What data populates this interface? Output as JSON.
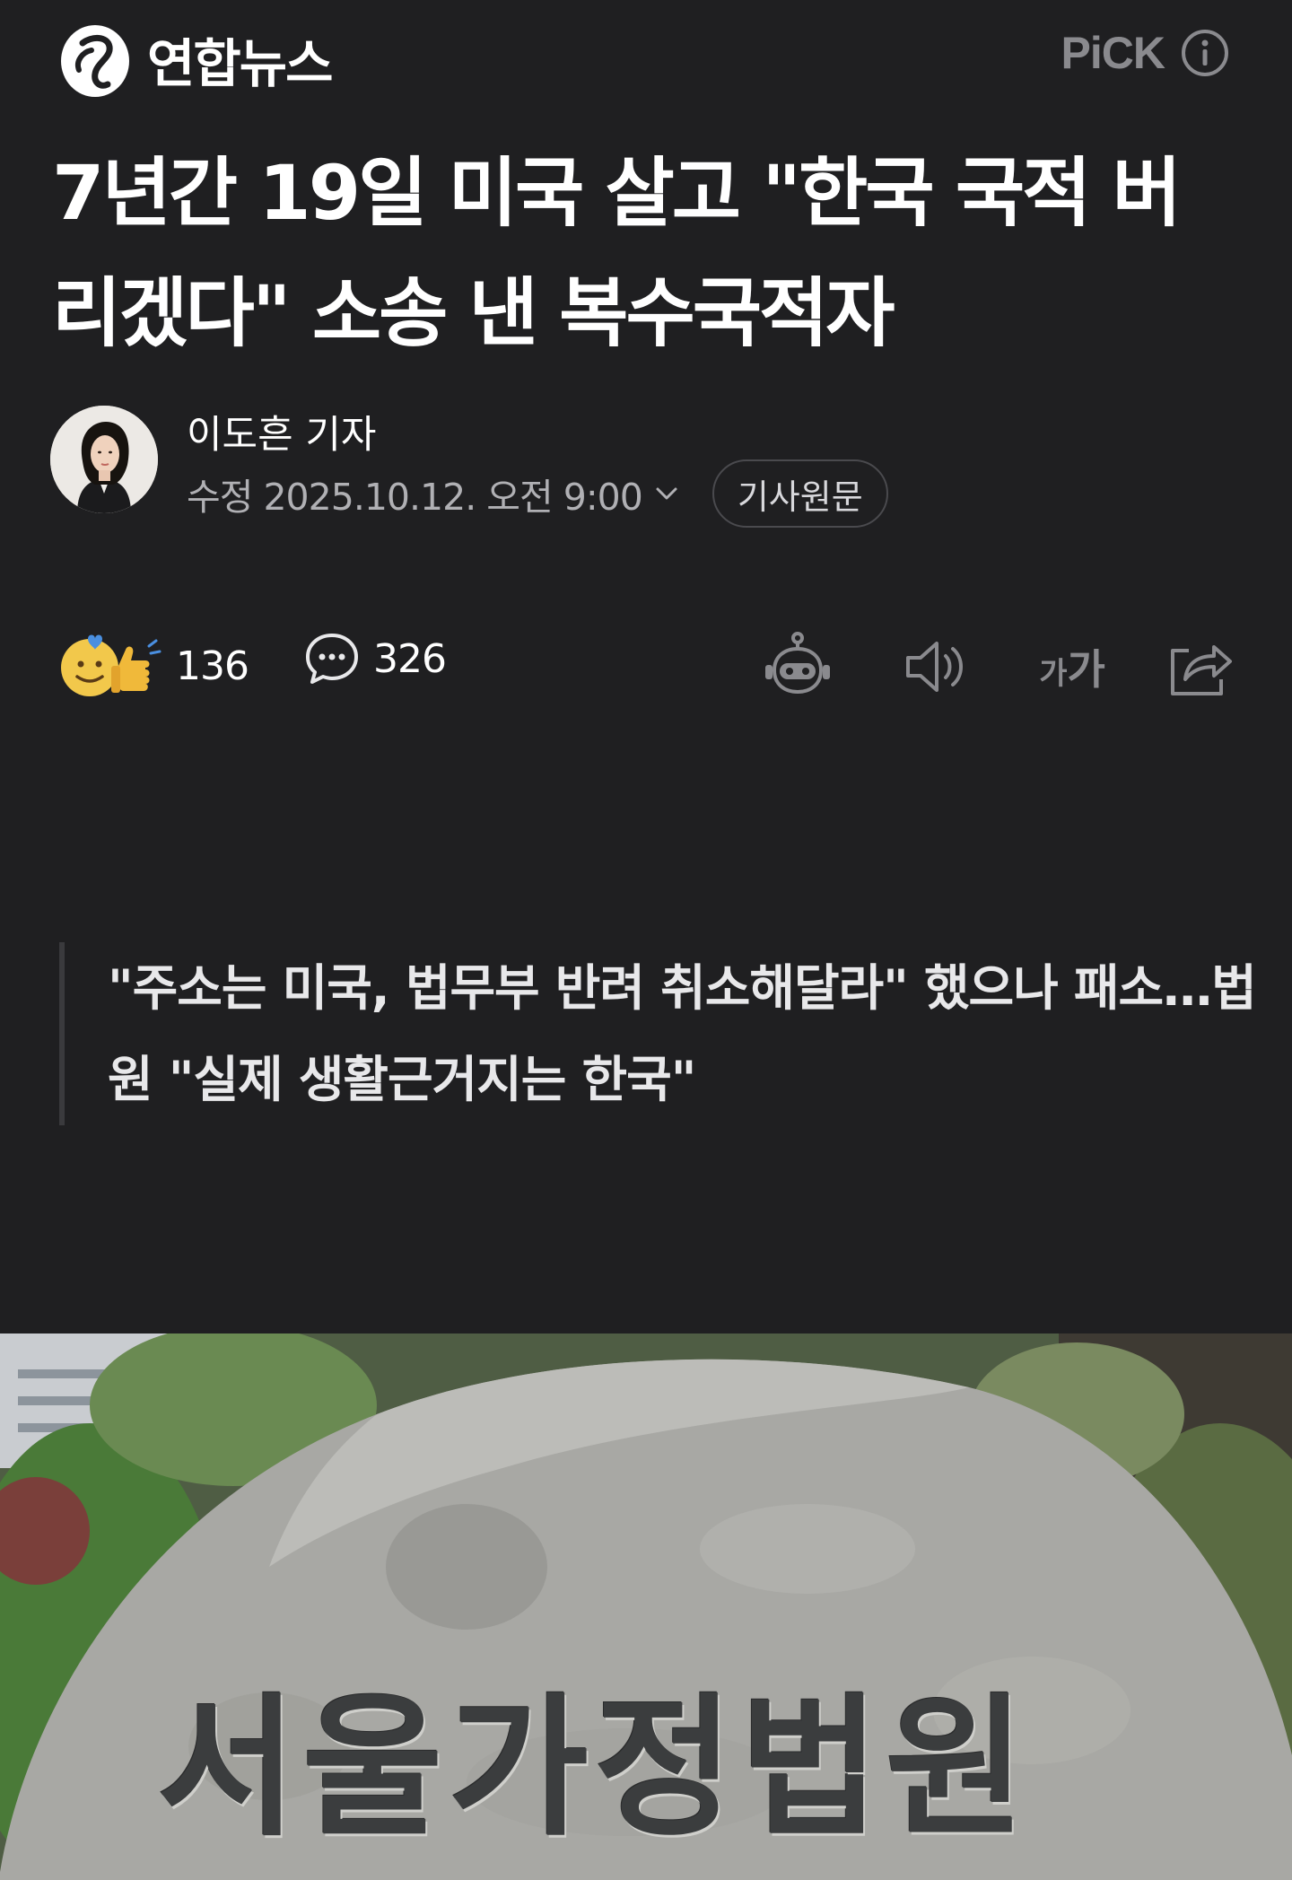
{
  "header": {
    "logo_text": "연합뉴스",
    "pick_label": "PiCK"
  },
  "article": {
    "headline": "7년간 19일 미국 살고 \"한국 국적 버리겠다\" 소송 낸 복수국적자",
    "author": "이도흔 기자",
    "date": "수정 2025.10.12. 오전 9:00",
    "original_button": "기사원문",
    "subhead": "\"주소는 미국, 법무부 반려 취소해달라\" 했으나 패소…법원 \"실제 생활근거지는 한국\"",
    "photo_sign_text": "서울가정법원"
  },
  "actions": {
    "reaction_count": "136",
    "comment_count": "326",
    "font_size_label_small": "가",
    "font_size_label_large": "가"
  },
  "colors": {
    "background": "#1f1f21",
    "text_primary": "#ffffff",
    "text_secondary": "#b0b0b4",
    "icon_gray": "#8a8a8e"
  }
}
